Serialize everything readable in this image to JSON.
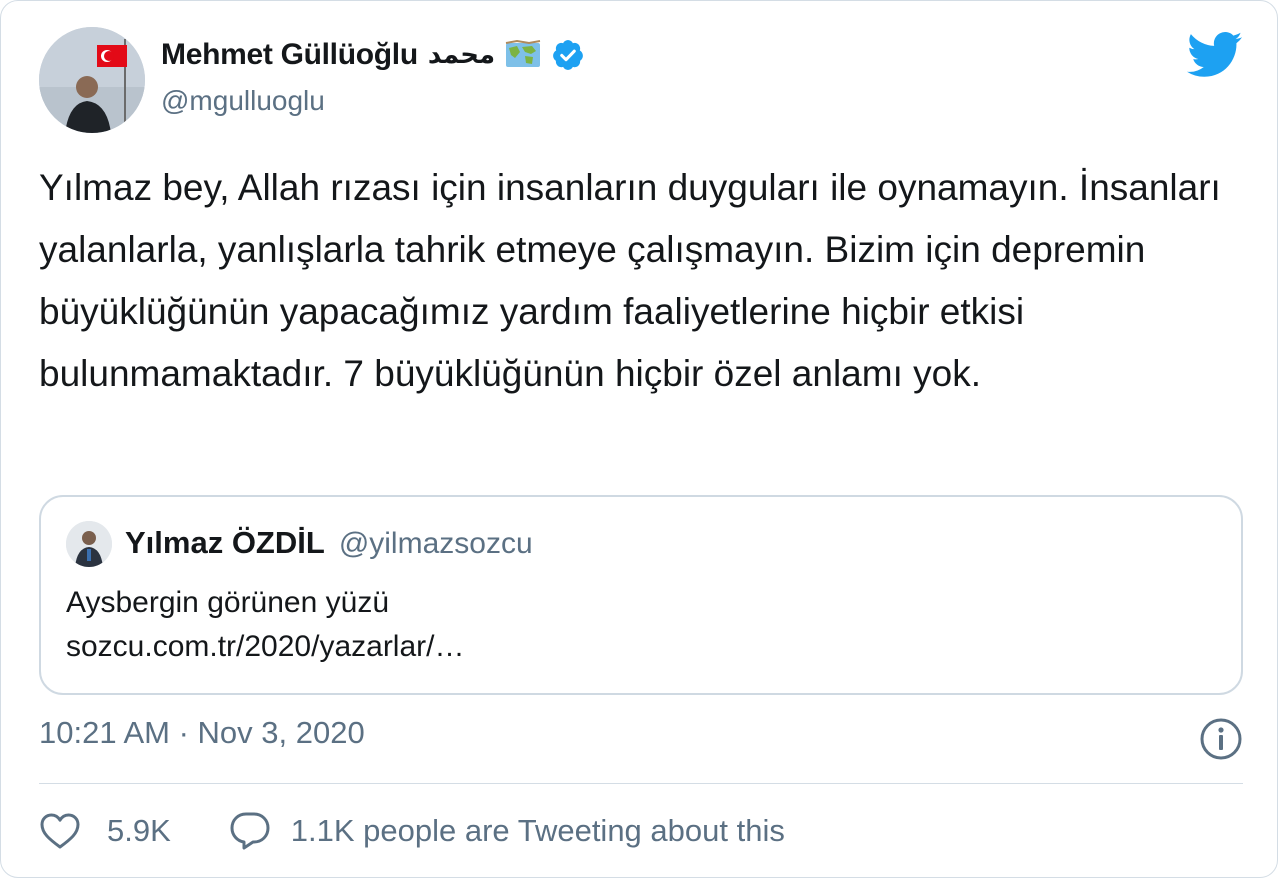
{
  "author": {
    "display_name": "Mehmet Güllüoğlu",
    "name_suffix_arabic": "محمد",
    "handle": "@mgulluoglu",
    "emoji_icon": "world-map-icon",
    "verified_icon": "verified-badge-icon"
  },
  "tweet": {
    "text": "Yılmaz bey, Allah rızası için insanların duyguları ile oynamayın. İnsanları yalanlarla, yanlışlarla tahrik etmeye çalışmayın. Bizim için depremin büyüklüğünün yapacağımız yardım faaliyetlerine hiçbir etkisi bulunmamaktadır. 7 büyüklüğünün hiçbir özel anlamı yok.",
    "timestamp": "10:21 AM · Nov 3, 2020"
  },
  "quoted_tweet": {
    "display_name": "Yılmaz ÖZDİL",
    "handle": "@yilmazsozcu",
    "text": "Aysbergin görünen yüzü",
    "link": "sozcu.com.tr/2020/yazarlar/…"
  },
  "actions": {
    "likes": "5.9K",
    "tweeting_text": "1.1K people are Tweeting about this"
  },
  "colors": {
    "twitter_blue": "#1da1f2",
    "secondary_text": "#5b7083",
    "border": "#d4dde5"
  }
}
